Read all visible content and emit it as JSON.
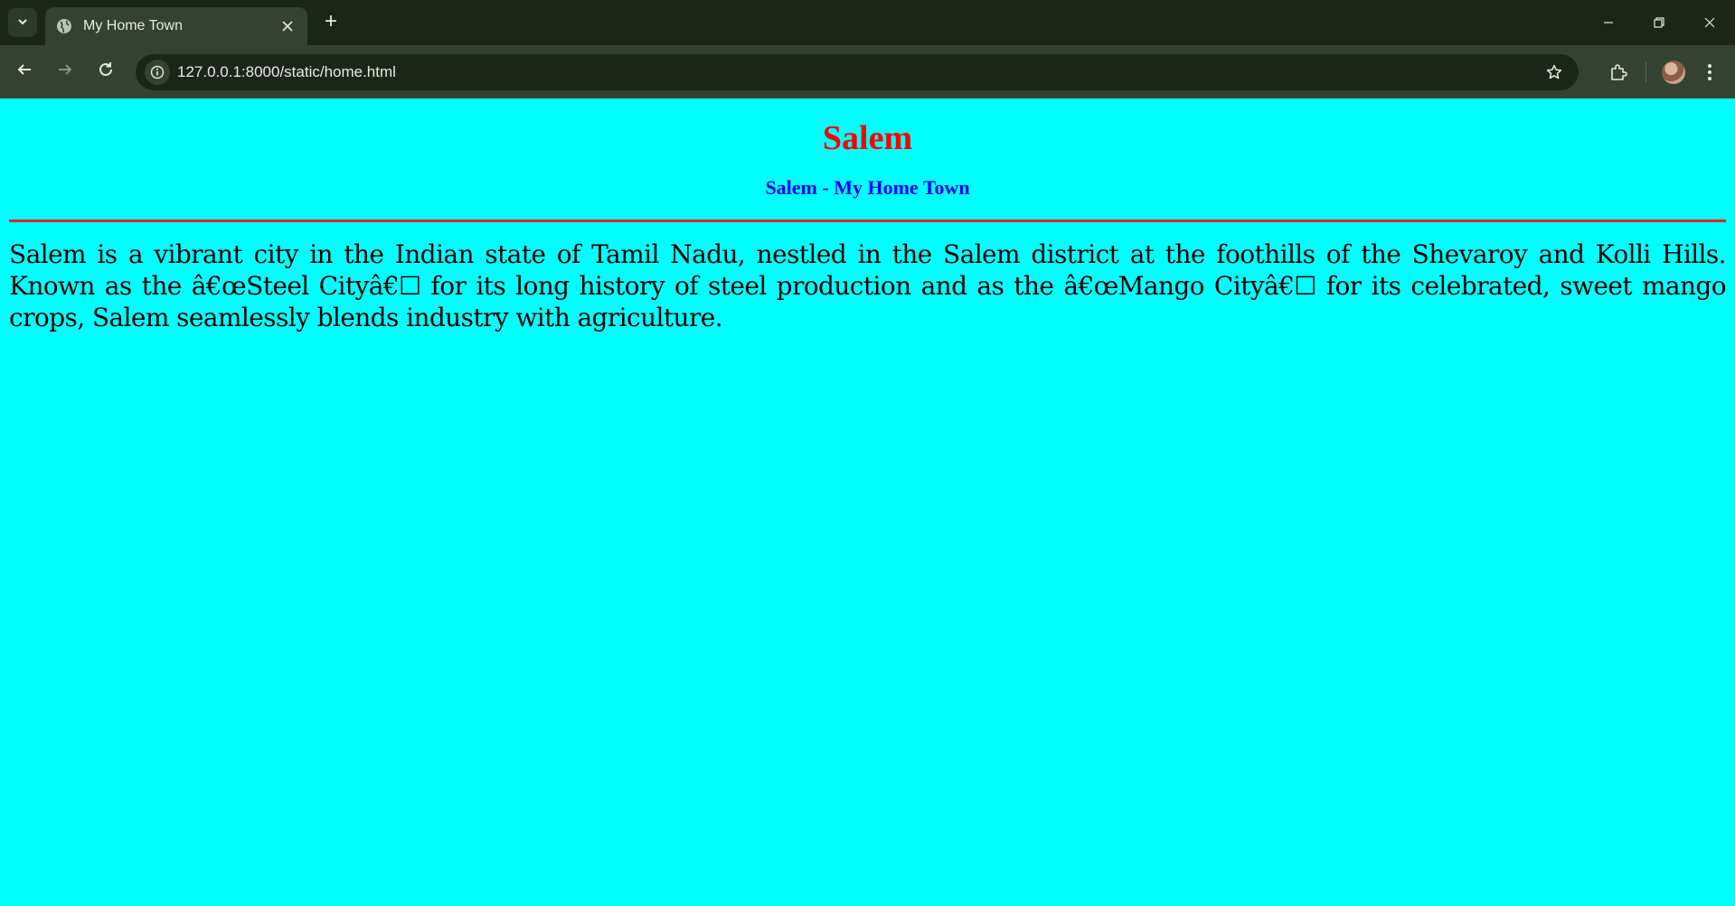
{
  "browser": {
    "tab": {
      "title": "My Home Town"
    },
    "new_tab_label": "+",
    "address_bar": {
      "url": "127.0.0.1:8000/static/home.html"
    }
  },
  "page": {
    "background_color": "#00ffff",
    "heading": "Salem",
    "heading_color": "#ff0000",
    "subheading": "Salem - My Home Town",
    "subheading_color": "#0000ff",
    "rule_color": "#e0262c",
    "paragraph": "Salem is a vibrant city in the Indian state of Tamil Nadu, nestled in the Salem district at the foothills of the Shevaroy and Kolli Hills. Known as the â€œSteel Cityâ€☐ for its long history of steel production and as the â€œMango Cityâ€☐ for its celebrated, sweet mango crops, Salem seamlessly blends industry with agriculture."
  },
  "icons": {
    "tab_search": "chevron-down-icon",
    "favicon": "globe-icon",
    "tab_close": "close-icon",
    "back": "arrow-left-icon",
    "forward": "arrow-right-icon",
    "reload": "reload-icon",
    "site_info": "info-icon",
    "bookmark": "star-icon",
    "extensions": "puzzle-icon",
    "profile": "avatar",
    "menu": "kebab-menu-icon",
    "minimize": "minimize-icon",
    "restore": "restore-icon",
    "close_window": "close-icon"
  }
}
